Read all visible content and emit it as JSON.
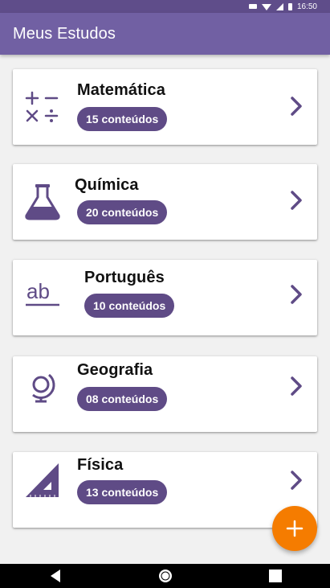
{
  "status_bar": {
    "time": "16:50"
  },
  "app_bar": {
    "title": "Meus Estudos"
  },
  "subjects": [
    {
      "name": "Matemática",
      "count": "15 conteúdos",
      "icon": "math-operators-icon"
    },
    {
      "name": "Química",
      "count": "20 conteúdos",
      "icon": "flask-icon"
    },
    {
      "name": "Português",
      "count": "10 conteúdos",
      "icon": "text-ab-icon"
    },
    {
      "name": "Geografia",
      "count": "08 conteúdos",
      "icon": "globe-icon"
    },
    {
      "name": "Física",
      "count": "13 conteúdos",
      "icon": "set-square-icon"
    }
  ],
  "fab": {
    "icon": "plus-icon"
  },
  "colors": {
    "primary": "#7160a3",
    "primary_dark": "#5f4d8a",
    "badge": "#5f4b86",
    "accent": "#f57c00"
  }
}
